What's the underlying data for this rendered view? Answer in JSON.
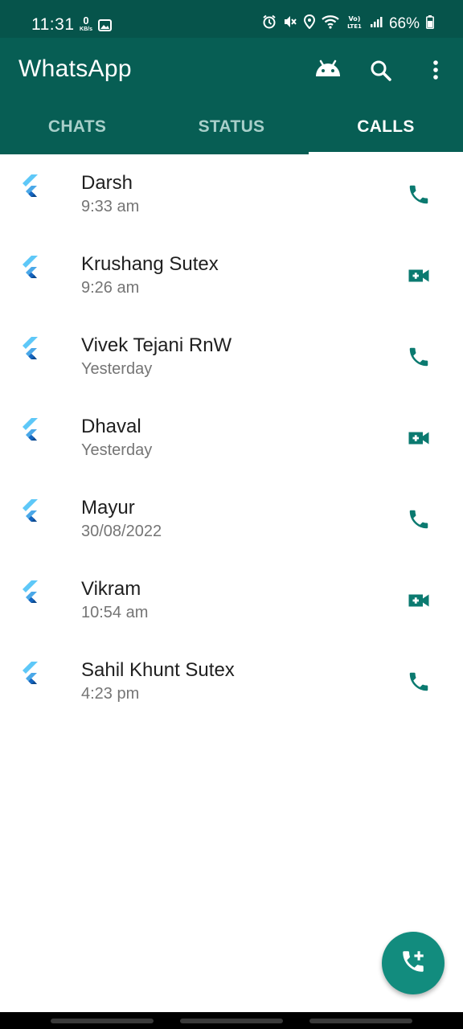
{
  "status_bar": {
    "time": "11:31",
    "netspeed_value": "0",
    "netspeed_unit": "KB/s",
    "battery": "66%",
    "icons": [
      "gallery-icon",
      "alarm-icon",
      "mute-icon",
      "location-icon",
      "wifi-icon",
      "volte-icon",
      "signal-icon",
      "battery-icon"
    ]
  },
  "app_bar": {
    "title": "WhatsApp",
    "actions": [
      "android-icon",
      "search-icon",
      "more-vert-icon"
    ]
  },
  "tabs": [
    {
      "label": "CHATS",
      "active": false
    },
    {
      "label": "STATUS",
      "active": false
    },
    {
      "label": "CALLS",
      "active": true
    }
  ],
  "calls": [
    {
      "name": "Darsh",
      "time": "9:33 am",
      "type": "voice"
    },
    {
      "name": "Krushang Sutex",
      "time": "9:26 am",
      "type": "video"
    },
    {
      "name": "Vivek Tejani RnW",
      "time": "Yesterday",
      "type": "voice"
    },
    {
      "name": "Dhaval",
      "time": "Yesterday",
      "type": "video"
    },
    {
      "name": "Mayur",
      "time": "30/08/2022",
      "type": "voice"
    },
    {
      "name": "Vikram",
      "time": "10:54 am",
      "type": "video"
    },
    {
      "name": "Sahil Khunt Sutex",
      "time": "4:23 pm",
      "type": "voice"
    }
  ],
  "fab": {
    "icon": "add-call-icon"
  },
  "colors": {
    "status_bar": "#06544b",
    "app_bar": "#075e54",
    "accent": "#128c7e",
    "icon_teal": "#0b7a70",
    "tab_inactive": "#a8cfca"
  }
}
